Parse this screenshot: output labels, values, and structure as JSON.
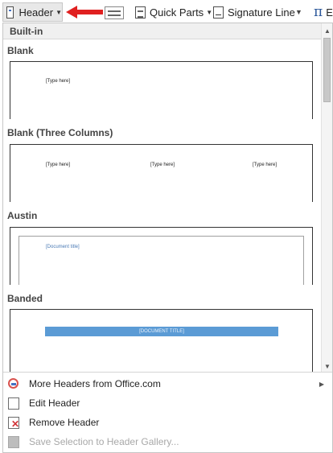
{
  "ribbon": {
    "header_label": "Header",
    "quick_parts_label": "Quick Parts",
    "signature_line_label": "Signature Line",
    "equation_symbol": "π",
    "equation_partial": "E"
  },
  "gallery": {
    "section_title": "Built-in",
    "items": [
      {
        "name": "Blank",
        "placeholders": [
          "[Type here]"
        ]
      },
      {
        "name": "Blank (Three Columns)",
        "placeholders": [
          "[Type here]",
          "[Type here]",
          "[Type here]"
        ]
      },
      {
        "name": "Austin",
        "placeholders": [
          "[Document title]"
        ]
      },
      {
        "name": "Banded",
        "placeholders": [
          "[DOCUMENT TITLE]"
        ]
      }
    ]
  },
  "menu": {
    "more_headers": "More Headers from Office.com",
    "edit_header": "Edit Header",
    "remove_header": "Remove Header",
    "save_selection": "Save Selection to Header Gallery..."
  },
  "colors": {
    "accent": "#2b579a",
    "arrow": "#e02020",
    "banded_bar": "#5b9bd5"
  }
}
